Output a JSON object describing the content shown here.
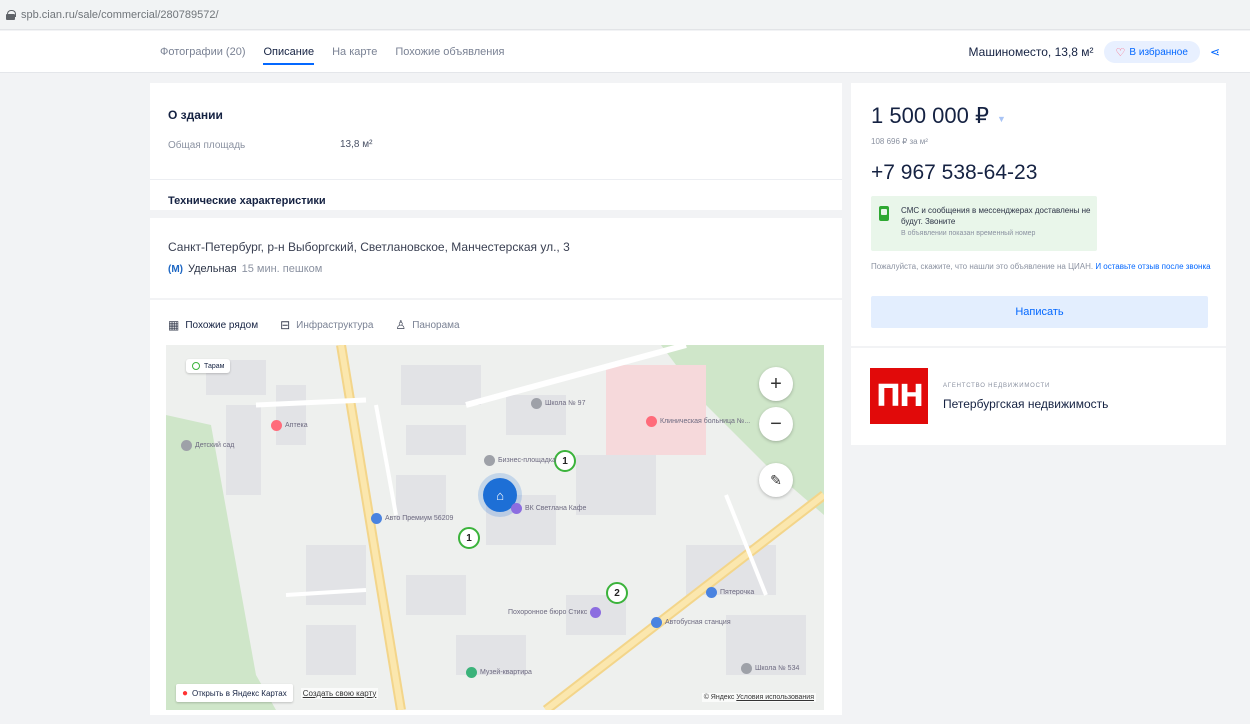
{
  "browser": {
    "url": "spb.cian.ru/sale/commercial/280789572/"
  },
  "tabs": [
    {
      "label": "Фотографии (20)"
    },
    {
      "label": "Описание"
    },
    {
      "label": "На карте"
    },
    {
      "label": "Похожие объявления"
    }
  ],
  "header": {
    "title": "Машиноместо, 13,8 м²",
    "favorite_label": "В избранное"
  },
  "building": {
    "heading": "О здании",
    "area_label": "Общая площадь",
    "area_value": "13,8 м²",
    "tech_heading": "Технические характеристики"
  },
  "address": {
    "text": "Санкт-Петербург, р-н Выборгский, Светлановское, Манчестерская ул., 3",
    "metro_station": "Удельная",
    "metro_time": "15 мин. пешком"
  },
  "map": {
    "tabs": [
      {
        "label": "Похожие рядом"
      },
      {
        "label": "Инфраструктура"
      },
      {
        "label": "Панорама"
      }
    ],
    "chip": "Тарам",
    "clusters": [
      "1",
      "1",
      "2"
    ],
    "pois": [
      {
        "name": "Школа № 97"
      },
      {
        "name": "Аптека"
      },
      {
        "name": "Клиническая больница №..."
      },
      {
        "name": "Бизнес-площадка"
      },
      {
        "name": "Авто Премиум 56209"
      },
      {
        "name": "ВК Светлана Кафе"
      },
      {
        "name": "Похоронное бюро Стикс"
      },
      {
        "name": "Автобусная станция"
      },
      {
        "name": "Пятерочка"
      },
      {
        "name": "Детский сад"
      },
      {
        "name": "Музей-квартира"
      },
      {
        "name": "Школа № 534"
      }
    ],
    "open_yandex": "Открыть в Яндекс Картах",
    "create_map": "Создать свою карту",
    "yandex": "© Яндекс",
    "terms": "Условия использования"
  },
  "price": {
    "value": "1 500 000 ₽",
    "per_m2": "108 696 ₽ за м²",
    "phone": "+7 967 538-64-23",
    "sms_text": "СМС и сообщения в мессенджерах доставлены не будут. Звоните",
    "sms_sub": "В объявлении показан временный номер",
    "notice": "Пожалуйста, скажите, что нашли это объявление на ЦИАН.",
    "notice_link": "И оставьте отзыв после звонка",
    "write_label": "Написать"
  },
  "agency": {
    "logo_text": "ПН",
    "kind": "АГЕНТСТВО НЕДВИЖИМОСТИ",
    "name": "Петербургская недвижимость"
  },
  "colors": {
    "accent": "#0468ff",
    "logo": "#e10a0a",
    "cluster": "#3bb33b",
    "pin": "#1d6fd6"
  }
}
